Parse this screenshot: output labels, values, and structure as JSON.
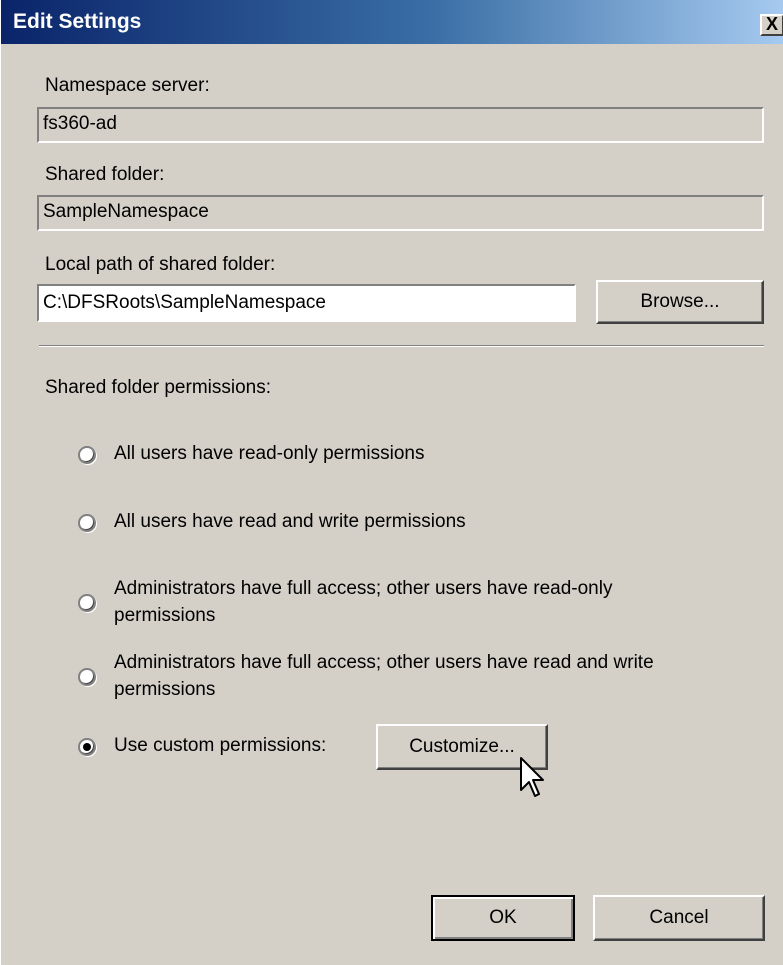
{
  "window": {
    "title": "Edit Settings",
    "close_glyph": "X"
  },
  "namespace_server": {
    "label": "Namespace server:",
    "value": "fs360-ad"
  },
  "shared_folder": {
    "label": "Shared folder:",
    "value": "SampleNamespace"
  },
  "local_path": {
    "label": "Local path of shared folder:",
    "value": "C:\\DFSRoots\\SampleNamespace",
    "browse_label": "Browse..."
  },
  "permissions": {
    "label": "Shared folder permissions:",
    "options": [
      {
        "label": "All users have read-only permissions",
        "selected": false
      },
      {
        "label": "All users have read and write permissions",
        "selected": false
      },
      {
        "label_line1": "Administrators have full access; other users have read-only",
        "label_line2": "permissions",
        "selected": false
      },
      {
        "label_line1": "Administrators have full access; other users have read and write",
        "label_line2": "permissions",
        "selected": false
      },
      {
        "label": "Use custom permissions:",
        "selected": true
      }
    ],
    "customize_label": "Customize..."
  },
  "buttons": {
    "ok_label": "OK",
    "cancel_label": "Cancel"
  },
  "colors": {
    "title_start": "#0a246a",
    "title_end": "#a6caf0",
    "dialog_bg": "#d4d0c8"
  },
  "icons": {
    "pointer": "arrow-cursor-icon"
  }
}
